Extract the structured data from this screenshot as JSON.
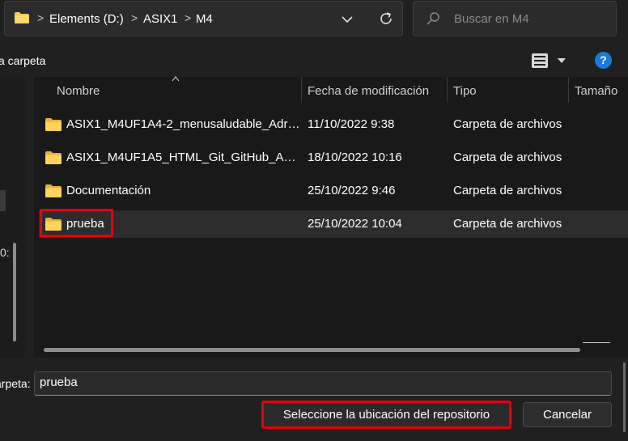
{
  "address": {
    "crumbs": [
      "Elements (D:)",
      "ASIX1",
      "M4"
    ],
    "separator": ">"
  },
  "search": {
    "placeholder": "Buscar en M4"
  },
  "toolbar": {
    "new_folder_label": "va carpeta",
    "help_label": "?"
  },
  "nav": {
    "partial_text": "0:"
  },
  "columns": {
    "name": "Nombre",
    "modified": "Fecha de modificación",
    "type": "Tipo",
    "size": "Tamaño"
  },
  "files": [
    {
      "name": "ASIX1_M4UF1A4-2_menusaludable_Adria...",
      "modified": "11/10/2022 9:38",
      "type": "Carpeta de archivos"
    },
    {
      "name": "ASIX1_M4UF1A5_HTML_Git_GitHub_Adri...",
      "modified": "18/10/2022 10:16",
      "type": "Carpeta de archivos"
    },
    {
      "name": "Documentación",
      "modified": "25/10/2022 9:46",
      "type": "Carpeta de archivos"
    },
    {
      "name": "prueba",
      "modified": "25/10/2022 10:04",
      "type": "Carpeta de archivos",
      "selected": true
    }
  ],
  "bottom": {
    "folder_label": "arpeta:",
    "folder_value": "prueba",
    "select_button": "Seleccione la ubicación del repositorio",
    "cancel_button": "Cancelar"
  },
  "colors": {
    "folder": "#f3c94f",
    "highlight": "#e3000f",
    "accent": "#1a7ad8"
  }
}
